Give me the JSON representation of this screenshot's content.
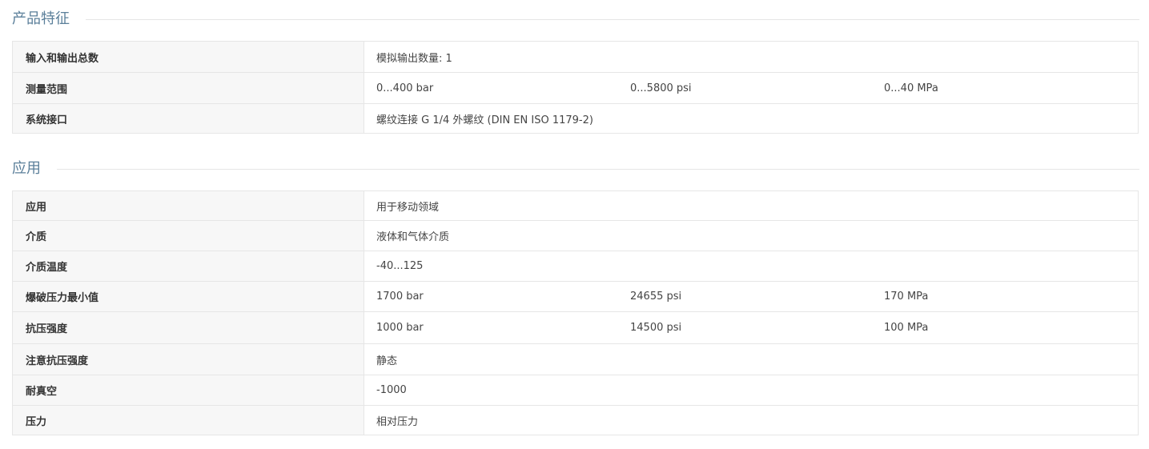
{
  "sections": {
    "features": {
      "title": "产品特征",
      "rows": [
        {
          "label": "输入和输出总数",
          "values": [
            "模拟输出数量: 1"
          ]
        },
        {
          "label": "测量范围",
          "values": [
            "0...400 bar",
            "0...5800 psi",
            "0...40 MPa"
          ]
        },
        {
          "label": "系统接口",
          "values": [
            "螺纹连接 G 1/4 外螺纹 (DIN EN ISO 1179-2)"
          ]
        }
      ]
    },
    "applications": {
      "title": "应用",
      "rows": [
        {
          "label": "应用",
          "values": [
            "用于移动领域"
          ]
        },
        {
          "label": "介质",
          "values": [
            "液体和气体介质"
          ]
        },
        {
          "label": "介质温度",
          "values": [
            "-40...125"
          ]
        },
        {
          "label": "爆破压力最小值",
          "values": [
            "1700 bar",
            "24655 psi",
            "170 MPa"
          ]
        },
        {
          "label": "抗压强度",
          "values": [
            "1000 bar",
            "14500 psi",
            "100 MPa"
          ]
        },
        {
          "label": "注意抗压强度",
          "values": [
            "静态"
          ]
        },
        {
          "label": "耐真空",
          "values": [
            "-1000"
          ]
        },
        {
          "label": "压力",
          "values": [
            "相对压力"
          ]
        }
      ]
    }
  },
  "colors": {
    "section_title": "#5b7f9a",
    "label_bg": "#f7f7f7",
    "border": "#e6e6e6"
  }
}
